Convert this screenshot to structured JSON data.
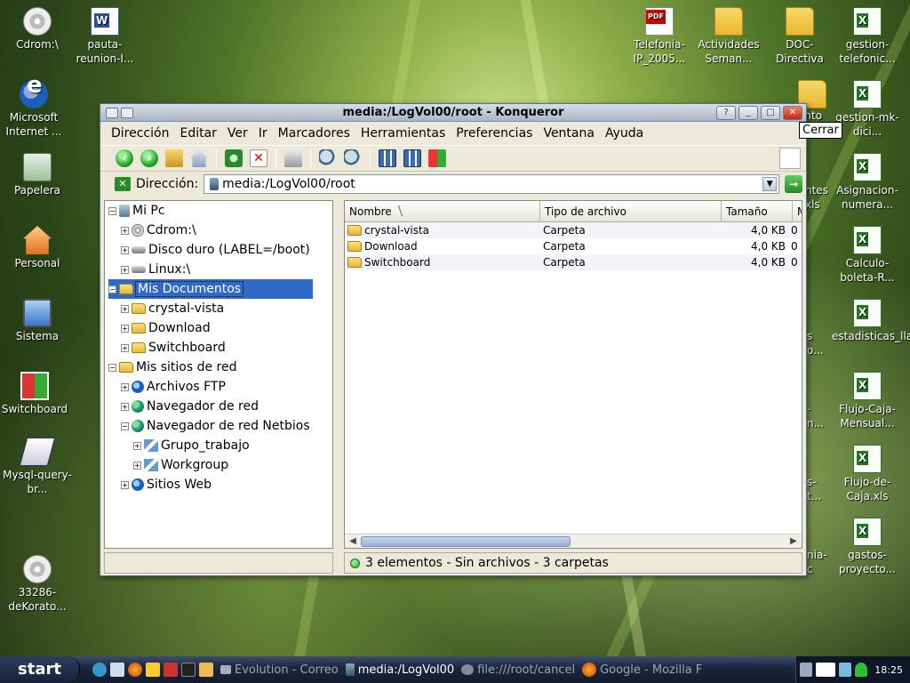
{
  "desktop": {
    "left_icons": [
      {
        "label": "Cdrom:\\"
      },
      {
        "label": "pauta-reunion-I..."
      },
      {
        "label": "Microsoft Internet ..."
      },
      {
        "label": "Papelera"
      },
      {
        "label": "Personal"
      },
      {
        "label": "Sistema"
      },
      {
        "label": "Switchboard"
      },
      {
        "label": "Mysql-query-br..."
      },
      {
        "label": "33286-deKorato..."
      }
    ],
    "right_icons": [
      {
        "label": "Telefonia-IP_2005..."
      },
      {
        "label": "Actividades Seman..."
      },
      {
        "label": "DOC-Directiva"
      },
      {
        "label": "gestion-telefonic..."
      },
      {
        "label": "gestion-mk-dici..."
      },
      {
        "label": "Asignacion-numera..."
      },
      {
        "label": "Calculo-boleta-R..."
      },
      {
        "label": "estadisticas_llamad..."
      },
      {
        "label": "Flujo-Caja-Mensual..."
      },
      {
        "label": "Flujo-de-Caja.xls"
      },
      {
        "label": "gastos-proyecto..."
      }
    ],
    "partial_labels": [
      "ento",
      "ntes",
      "xls",
      "s",
      "o...",
      "-",
      "n...",
      "s-",
      "t...",
      "nia-",
      "c"
    ]
  },
  "window": {
    "title": "media:/LogVol00/root - Konqueror",
    "tooltip": "Cerrar",
    "menu": [
      "Dirección",
      "Editar",
      "Ver",
      "Ir",
      "Marcadores",
      "Herramientas",
      "Preferencias",
      "Ventana",
      "Ayuda"
    ],
    "location_label": "Dirección:",
    "location_value": "media:/LogVol00/root",
    "tree": [
      {
        "label": "Mi Pc"
      },
      {
        "label": "Cdrom:\\"
      },
      {
        "label": "Disco duro (LABEL=/boot)"
      },
      {
        "label": "Linux:\\"
      },
      {
        "label": "Mis Documentos"
      },
      {
        "label": "crystal-vista"
      },
      {
        "label": "Download"
      },
      {
        "label": "Switchboard"
      },
      {
        "label": "Mis sitios de red"
      },
      {
        "label": "Archivos FTP"
      },
      {
        "label": "Navegador de red"
      },
      {
        "label": "Navegador de red Netbios"
      },
      {
        "label": "Grupo_trabajo"
      },
      {
        "label": "Workgroup"
      },
      {
        "label": "Sitios Web"
      }
    ],
    "columns": [
      "Nombre",
      "Tipo de archivo",
      "Tamaño",
      "M"
    ],
    "files": [
      {
        "name": "crystal-vista",
        "type": "Carpeta",
        "size": "4,0 KB",
        "m": "0"
      },
      {
        "name": "Download",
        "type": "Carpeta",
        "size": "4,0 KB",
        "m": "0"
      },
      {
        "name": "Switchboard",
        "type": "Carpeta",
        "size": "4,0 KB",
        "m": "0"
      }
    ],
    "status": "3 elementos - Sin archivos - 3 carpetas"
  },
  "taskbar": {
    "start": "start",
    "tasks": [
      {
        "label": "Evolution - Correo"
      },
      {
        "label": "media:/LogVol00"
      },
      {
        "label": "file:///root/cancel"
      },
      {
        "label": "Google - Mozilla F"
      }
    ],
    "clock": "18:25"
  }
}
